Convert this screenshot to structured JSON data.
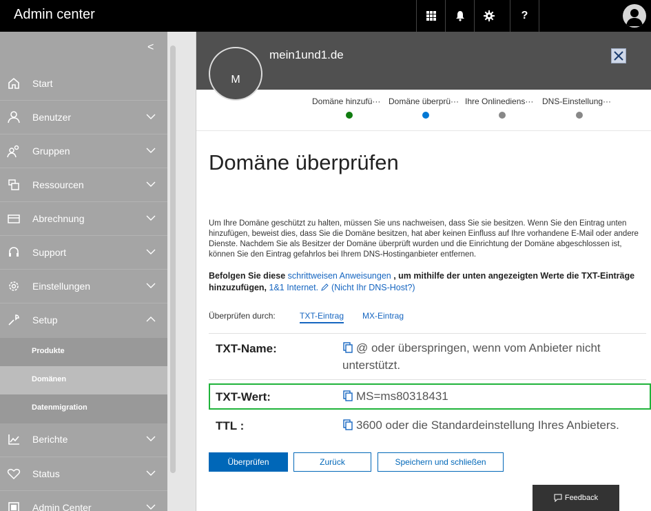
{
  "app": {
    "title": "Admin center"
  },
  "topbar": {
    "icons": [
      "apps-grid-icon",
      "bell-icon",
      "gear-icon",
      "help-icon",
      "user-avatar-icon"
    ],
    "help_label": "?"
  },
  "sidebar": {
    "collapse_glyph": "<",
    "items": [
      {
        "label": "Start",
        "icon": "home-icon"
      },
      {
        "label": "Benutzer",
        "icon": "person-icon"
      },
      {
        "label": "Gruppen",
        "icon": "group-icon"
      },
      {
        "label": "Ressourcen",
        "icon": "resources-icon"
      },
      {
        "label": "Abrechnung",
        "icon": "billing-icon"
      },
      {
        "label": "Support",
        "icon": "headset-icon"
      },
      {
        "label": "Einstellungen",
        "icon": "settings-icon"
      },
      {
        "label": "Setup",
        "icon": "wrench-icon"
      },
      {
        "label": "Berichte",
        "icon": "chart-icon"
      },
      {
        "label": "Status",
        "icon": "heart-icon"
      },
      {
        "label": "Admin Center",
        "icon": "admin-center-icon"
      }
    ],
    "setup_sub": [
      {
        "label": "Produkte"
      },
      {
        "label": "Domänen",
        "active": true
      },
      {
        "label": "Datenmigration"
      }
    ]
  },
  "panel": {
    "avatar_initial": "M",
    "domain": "mein1und1.de",
    "steps": [
      {
        "label": "Domäne hinzufü···",
        "status": "done",
        "color": "#107c10"
      },
      {
        "label": "Domäne überprü···",
        "status": "current",
        "color": "#0078d4"
      },
      {
        "label": "Ihre Onlinediens···",
        "status": "pending",
        "color": "#888888"
      },
      {
        "label": "DNS-Einstellung···",
        "status": "pending",
        "color": "#888888"
      }
    ],
    "heading": "Domäne überprüfen",
    "description": "Um Ihre Domäne geschützt zu halten, müssen Sie uns nachweisen, dass Sie sie besitzen. Wenn Sie den Eintrag unten hinzufügen, beweist dies, dass Sie die Domäne besitzen, hat aber keinen Einfluss auf Ihre vorhandene E-Mail oder andere Dienste. Nachdem Sie als Besitzer der Domäne überprüft wurden und die Einrichtung der Domäne abgeschlossen ist, können Sie den Eintrag gefahrlos bei Ihrem DNS-Hostinganbieter entfernen.",
    "instruction": {
      "prefix": "Befolgen Sie diese",
      "link": "schrittweisen Anweisungen",
      "middle": ", um mithilfe der unten angezeigten Werte die TXT-Einträge hinzuzufügen,",
      "host_link": "1&1 Internet.",
      "not_host": "(Nicht Ihr DNS-Host?)"
    },
    "verify_by_label": "Überprüfen durch:",
    "tabs": [
      {
        "label": "TXT-Eintrag",
        "active": true
      },
      {
        "label": "MX-Eintrag",
        "active": false
      }
    ],
    "records": [
      {
        "label": "TXT-Name:",
        "value": "@ oder überspringen, wenn vom Anbieter nicht unterstützt."
      },
      {
        "label": "TXT-Wert:",
        "value": "MS=ms80318431"
      },
      {
        "label": "TTL :",
        "value": "3600 oder die Standardeinstellung Ihres Anbieters."
      }
    ],
    "buttons": {
      "verify": "Überprüfen",
      "back": "Zurück",
      "save_close": "Speichern und schließen"
    }
  },
  "feedback": {
    "label": "Feedback"
  }
}
